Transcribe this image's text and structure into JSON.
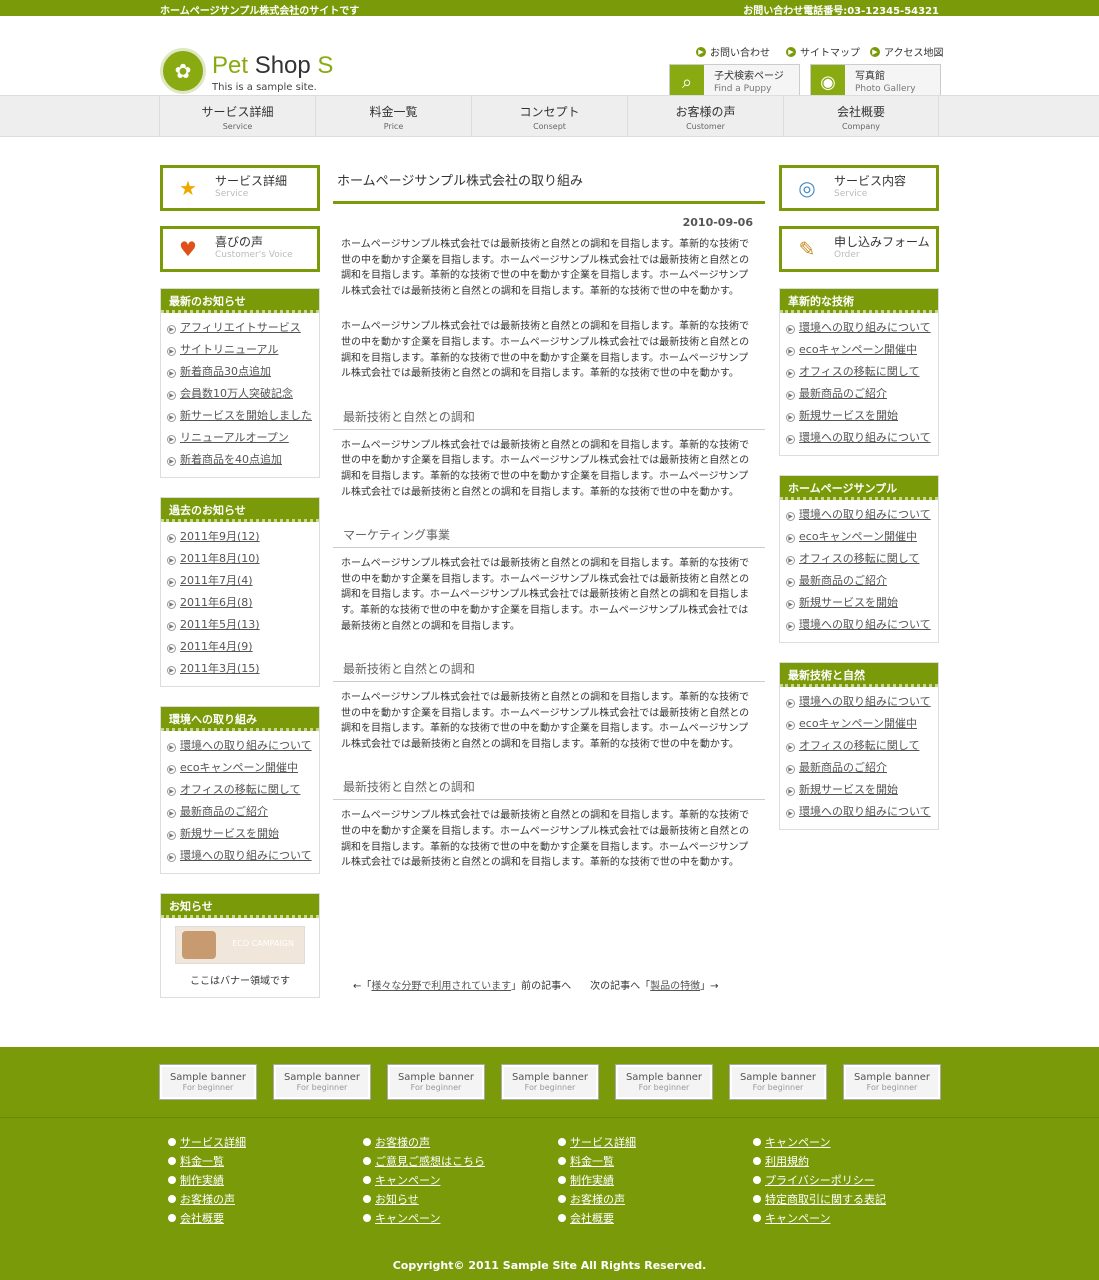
{
  "topbar": {
    "left": "ホームページサンプル株式会社のサイトです",
    "right": "お問い合わせ電話番号:03-12345-54321"
  },
  "logo": {
    "title_a": "Pet",
    "title_b": " Shop ",
    "title_c": "S",
    "sub": "This is a sample site."
  },
  "header_links": [
    {
      "label": "お問い合わせ"
    },
    {
      "label": "サイトマップ"
    },
    {
      "label": "アクセス地図"
    }
  ],
  "header_buttons": [
    {
      "label": "子犬検索ページ",
      "sub": "Find a Puppy",
      "icon": "magnifier-icon"
    },
    {
      "label": "写真館",
      "sub": "Photo Gallery",
      "icon": "camera-icon"
    }
  ],
  "nav": [
    {
      "jp": "サービス詳細",
      "en": "Service"
    },
    {
      "jp": "料金一覧",
      "en": "Price"
    },
    {
      "jp": "コンセプト",
      "en": "Consept"
    },
    {
      "jp": "お客様の声",
      "en": "Customer"
    },
    {
      "jp": "会社概要",
      "en": "Company"
    }
  ],
  "left_buttons": [
    {
      "label": "サービス詳細",
      "sub": "Service",
      "icon": "star-icon"
    },
    {
      "label": "喜びの声",
      "sub": "Customer's Voice",
      "icon": "heart-icon"
    }
  ],
  "left_boxes": [
    {
      "title": "最新のお知らせ",
      "items": [
        "アフィリエイトサービス",
        "サイトリニューアル",
        "新着商品30点追加",
        "会員数10万人突破記念",
        "新サービスを開始しました",
        "リニューアルオープン",
        "新着商品を40点追加"
      ]
    },
    {
      "title": "過去のお知らせ",
      "items": [
        "2011年9月(12)",
        "2011年8月(10)",
        "2011年7月(4)",
        "2011年6月(8)",
        "2011年5月(13)",
        "2011年4月(9)",
        "2011年3月(15)"
      ]
    },
    {
      "title": "環境への取り組み",
      "items": [
        "環境への取り組みについて",
        "ecoキャンペーン開催中",
        "オフィスの移転に関して",
        "最新商品のご紹介",
        "新規サービスを開始",
        "環境への取り組みについて"
      ]
    }
  ],
  "notice": {
    "title": "お知らせ",
    "banner_text": "ECO CAMPAIGN",
    "caption": "ここはバナー領域です"
  },
  "right_buttons": [
    {
      "label": "サービス内容",
      "sub": "Service",
      "icon": "globe-icon"
    },
    {
      "label": "申し込みフォーム",
      "sub": "Order",
      "icon": "pencil-icon"
    }
  ],
  "right_boxes": [
    {
      "title": "革新的な技術",
      "items": [
        "環境への取り組みについて",
        "ecoキャンペーン開催中",
        "オフィスの移転に関して",
        "最新商品のご紹介",
        "新規サービスを開始",
        "環境への取り組みについて"
      ]
    },
    {
      "title": "ホームページサンプル",
      "items": [
        "環境への取り組みについて",
        "ecoキャンペーン開催中",
        "オフィスの移転に関して",
        "最新商品のご紹介",
        "新規サービスを開始",
        "環境への取り組みについて"
      ]
    },
    {
      "title": "最新技術と自然",
      "items": [
        "環境への取り組みについて",
        "ecoキャンペーン開催中",
        "オフィスの移転に関して",
        "最新商品のご紹介",
        "新規サービスを開始",
        "環境への取り組みについて"
      ]
    }
  ],
  "main": {
    "title": "ホームページサンプル株式会社の取り組み",
    "date": "2010-09-06",
    "p1": "ホームページサンプル株式会社では最新技術と自然との調和を目指します。革新的な技術で世の中を動かす企業を目指します。ホームページサンプル株式会社では最新技術と自然との調和を目指します。革新的な技術で世の中を動かす企業を目指します。ホームページサンプル株式会社では最新技術と自然との調和を目指します。革新的な技術で世の中を動かす。",
    "p2": "ホームページサンプル株式会社では最新技術と自然との調和を目指します。革新的な技術で世の中を動かす企業を目指します。ホームページサンプル株式会社では最新技術と自然との調和を目指します。革新的な技術で世の中を動かす企業を目指します。ホームページサンプル株式会社では最新技術と自然との調和を目指します。革新的な技術で世の中を動かす。",
    "h1": "最新技術と自然との調和",
    "p3": "ホームページサンプル株式会社では最新技術と自然との調和を目指します。革新的な技術で世の中を動かす企業を目指します。ホームページサンプル株式会社では最新技術と自然との調和を目指します。革新的な技術で世の中を動かす企業を目指します。ホームページサンプル株式会社では最新技術と自然との調和を目指します。革新的な技術で世の中を動かす。",
    "h2": "マーケティング事業",
    "p4": "ホームページサンプル株式会社では最新技術と自然との調和を目指します。革新的な技術で世の中を動かす企業を目指します。ホームページサンプル株式会社では最新技術と自然との調和を目指します。ホームページサンプル株式会社では最新技術と自然との調和を目指します。革新的な技術で世の中を動かす企業を目指します。ホームページサンプル株式会社では最新技術と自然との調和を目指します。",
    "h3": "最新技術と自然との調和",
    "p5": "ホームページサンプル株式会社では最新技術と自然との調和を目指します。革新的な技術で世の中を動かす企業を目指します。ホームページサンプル株式会社では最新技術と自然との調和を目指します。革新的な技術で世の中を動かす企業を目指します。ホームページサンプル株式会社では最新技術と自然との調和を目指します。革新的な技術で世の中を動かす。",
    "h4": "最新技術と自然との調和",
    "p6": "ホームページサンプル株式会社では最新技術と自然との調和を目指します。革新的な技術で世の中を動かす企業を目指します。ホームページサンプル株式会社では最新技術と自然との調和を目指します。革新的な技術で世の中を動かす企業を目指します。ホームページサンプル株式会社では最新技術と自然との調和を目指します。革新的な技術で世の中を動かす。"
  },
  "pager": {
    "prev_pre": "←「",
    "prev_link": "様々な分野で利用されています",
    "prev_post": "」前の記事へ",
    "next_pre": "次の記事へ「",
    "next_link": "製品の特徴",
    "next_post": "」→"
  },
  "banners": [
    {
      "label": "Sample banner",
      "sub": "For beginner"
    },
    {
      "label": "Sample banner",
      "sub": "For beginner"
    },
    {
      "label": "Sample banner",
      "sub": "For beginner"
    },
    {
      "label": "Sample banner",
      "sub": "For beginner"
    },
    {
      "label": "Sample banner",
      "sub": "For beginner"
    },
    {
      "label": "Sample banner",
      "sub": "For beginner"
    },
    {
      "label": "Sample banner",
      "sub": "For beginner"
    }
  ],
  "footer_cols": [
    [
      "サービス詳細",
      "料金一覧",
      "制作実績",
      "お客様の声",
      "会社概要"
    ],
    [
      "お客様の声",
      "ご意見ご感想はこちら",
      "キャンペーン",
      "お知らせ",
      "キャンペーン"
    ],
    [
      "サービス詳細",
      "料金一覧",
      "制作実績",
      "お客様の声",
      "会社概要"
    ],
    [
      "キャンペーン",
      "利用規約",
      "プライバシーポリシー",
      "特定商取引に関する表記",
      "キャンペーン"
    ]
  ],
  "copyright": "Copyright© 2011 Sample Site All Rights Reserved.",
  "colors": {
    "accent": "#7a9a0a"
  }
}
